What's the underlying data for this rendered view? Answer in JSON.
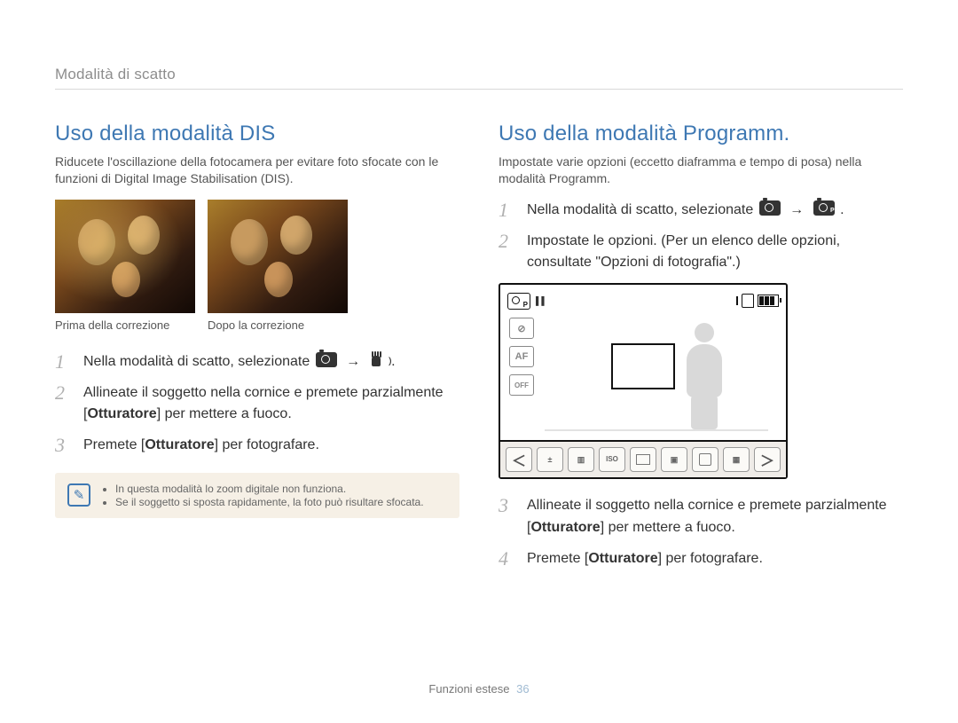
{
  "breadcrumb": "Modalità di scatto",
  "left": {
    "title": "Uso della modalità DIS",
    "intro": "Riducete l'oscillazione della fotocamera per evitare foto sfocate con le funzioni di Digital Image Stabilisation (DIS).",
    "caption_before": "Prima della correzione",
    "caption_after": "Dopo la correzione",
    "steps": {
      "1": {
        "num": "1",
        "prefix": "Nella modalità di scatto, selezionate ",
        "suffix": "."
      },
      "2": {
        "num": "2",
        "a": "Allineate il soggetto nella cornice e premete parzialmente [",
        "b": "Otturatore",
        "c": "] per mettere a fuoco."
      },
      "3": {
        "num": "3",
        "a": "Premete [",
        "b": "Otturatore",
        "c": "] per fotografare."
      }
    },
    "notes": [
      "In questa modalità lo zoom digitale non funziona.",
      "Se il soggetto si sposta rapidamente, la foto può risultare sfocata."
    ]
  },
  "right": {
    "title": "Uso della modalità Programm.",
    "intro": "Impostate varie opzioni (eccetto diaframma e tempo di posa) nella modalità Programm.",
    "steps": {
      "1": {
        "num": "1",
        "prefix": "Nella modalità di scatto, selezionate ",
        "suffix": "."
      },
      "2": {
        "num": "2",
        "text": "Impostate le opzioni. (Per un elenco delle opzioni, consultate \"Opzioni di fotografia\".)"
      },
      "3": {
        "num": "3",
        "a": "Allineate il soggetto nella cornice e premete parzialmente [",
        "b": "Otturatore",
        "c": "] per mettere a fuoco."
      },
      "4": {
        "num": "4",
        "a": "Premete [",
        "b": "Otturatore",
        "c": "] per fotografare."
      }
    }
  },
  "lcd": {
    "side1": "⊘",
    "side2": "AF",
    "side3": "OFF",
    "toolbar_iso": "ISO",
    "arrow_left": "＜",
    "arrow_right": "＞"
  },
  "footer": {
    "label": "Funzioni estese",
    "page": "36"
  },
  "arrow_glyph": "→"
}
